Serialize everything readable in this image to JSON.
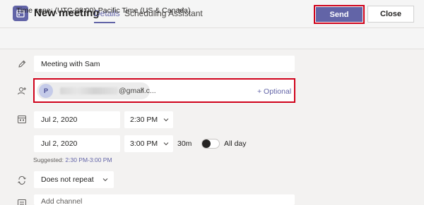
{
  "header": {
    "title": "New meeting",
    "tabs": [
      {
        "label": "Details"
      },
      {
        "label": "Scheduling Assistant"
      }
    ],
    "send_label": "Send",
    "close_label": "Close"
  },
  "timezone": {
    "label": "Time zone: (UTC-08:00) Pacific Time (US & Canada)"
  },
  "form": {
    "title_value": "Meeting with Sam",
    "attendee": {
      "initial": "P",
      "email_visible": "@gmail.c...",
      "remove_glyph": "×",
      "optional_label": "+ Optional"
    },
    "start_date": "Jul 2, 2020",
    "start_time": "2:30 PM",
    "end_date": "Jul 2, 2020",
    "end_time": "3:00 PM",
    "duration": "30m",
    "all_day_label": "All day",
    "suggested_prefix": "Suggested:",
    "suggested_slot": "2:30 PM-3:00 PM",
    "repeat_value": "Does not repeat",
    "channel_placeholder": "Add channel"
  },
  "colors": {
    "accent": "#6264a7",
    "highlight_outline": "#d0021b"
  },
  "icons": [
    "calendar-icon",
    "pencil-icon",
    "add-person-icon",
    "calendar-icon",
    "repeat-icon",
    "channel-icon",
    "chevron-down-icon"
  ]
}
